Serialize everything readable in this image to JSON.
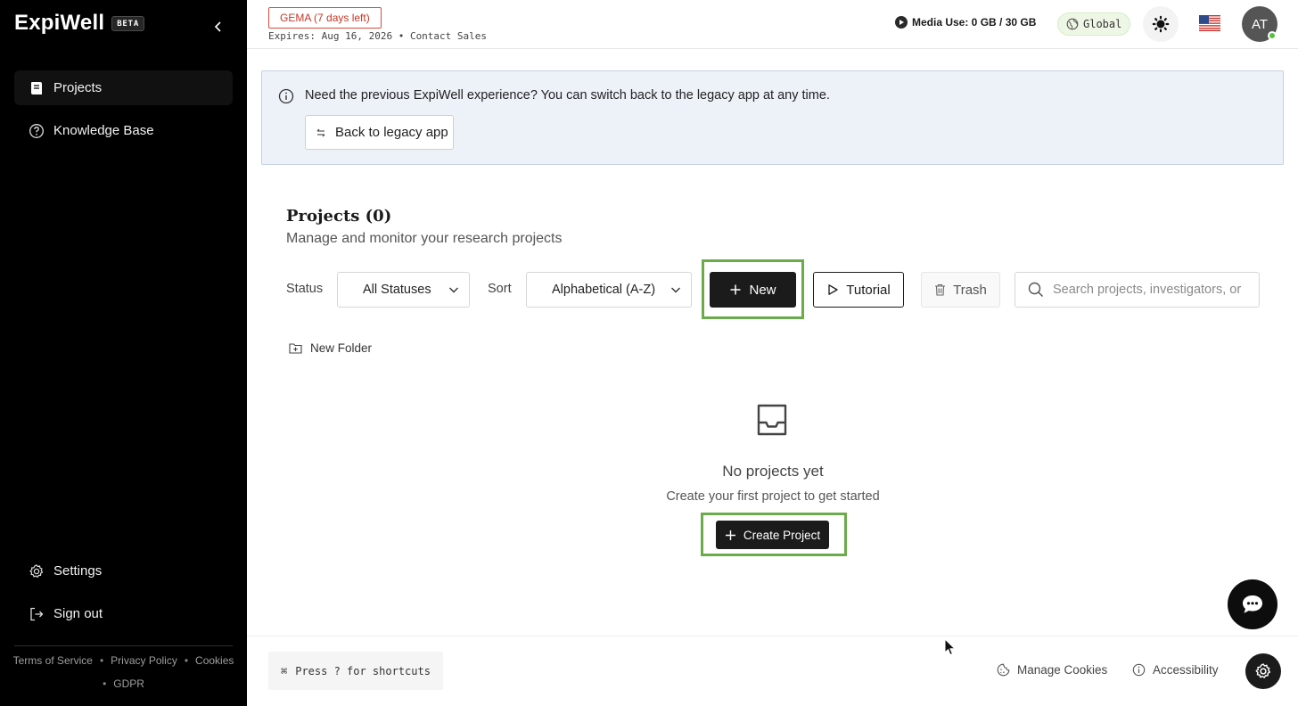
{
  "sidebar": {
    "logo_text": "ExpiWell",
    "beta_label": "BETA",
    "nav": [
      {
        "label": "Projects",
        "icon": "notebook-icon",
        "active": true
      },
      {
        "label": "Knowledge Base",
        "icon": "question-circle-icon",
        "active": false
      }
    ],
    "bottom_nav": [
      {
        "label": "Settings",
        "icon": "gear-icon"
      },
      {
        "label": "Sign out",
        "icon": "sign-out-icon"
      }
    ],
    "footer_links": [
      "Terms of Service",
      "Privacy Policy",
      "Cookies",
      "GDPR"
    ]
  },
  "topbar": {
    "plan_badge": "GEMA (7 days left)",
    "expires_text": "Expires: Aug 16, 2026 • Contact Sales",
    "media_use": "Media Use: 0 GB / 30 GB",
    "region": "Global",
    "avatar_initials": "AT"
  },
  "notice": {
    "text": "Need the previous ExpiWell experience? You can switch back to the legacy app at any time.",
    "button_label": "Back to legacy app"
  },
  "projects": {
    "title": "Projects (0)",
    "subtitle": "Manage and monitor your research projects",
    "status_label": "Status",
    "status_value": "All Statuses",
    "sort_label": "Sort",
    "sort_value": "Alphabetical (A-Z)",
    "new_label": "New",
    "tutorial_label": "Tutorial",
    "trash_label": "Trash",
    "search_placeholder": "Search projects, investigators, or",
    "new_folder_label": "New Folder"
  },
  "empty_state": {
    "title": "No projects yet",
    "subtitle": "Create your first project to get started",
    "button_label": "Create Project"
  },
  "footer": {
    "shortcut_symbol": "⌘",
    "shortcut_text": "Press ? for shortcuts",
    "manage_cookies": "Manage Cookies",
    "accessibility": "Accessibility"
  },
  "colors": {
    "sidebar_bg": "#000000",
    "accent_dark": "#1b1b1b",
    "highlight_green": "#6aab4a",
    "notice_bg": "#edf2f9",
    "badge_red": "#c4382a"
  }
}
